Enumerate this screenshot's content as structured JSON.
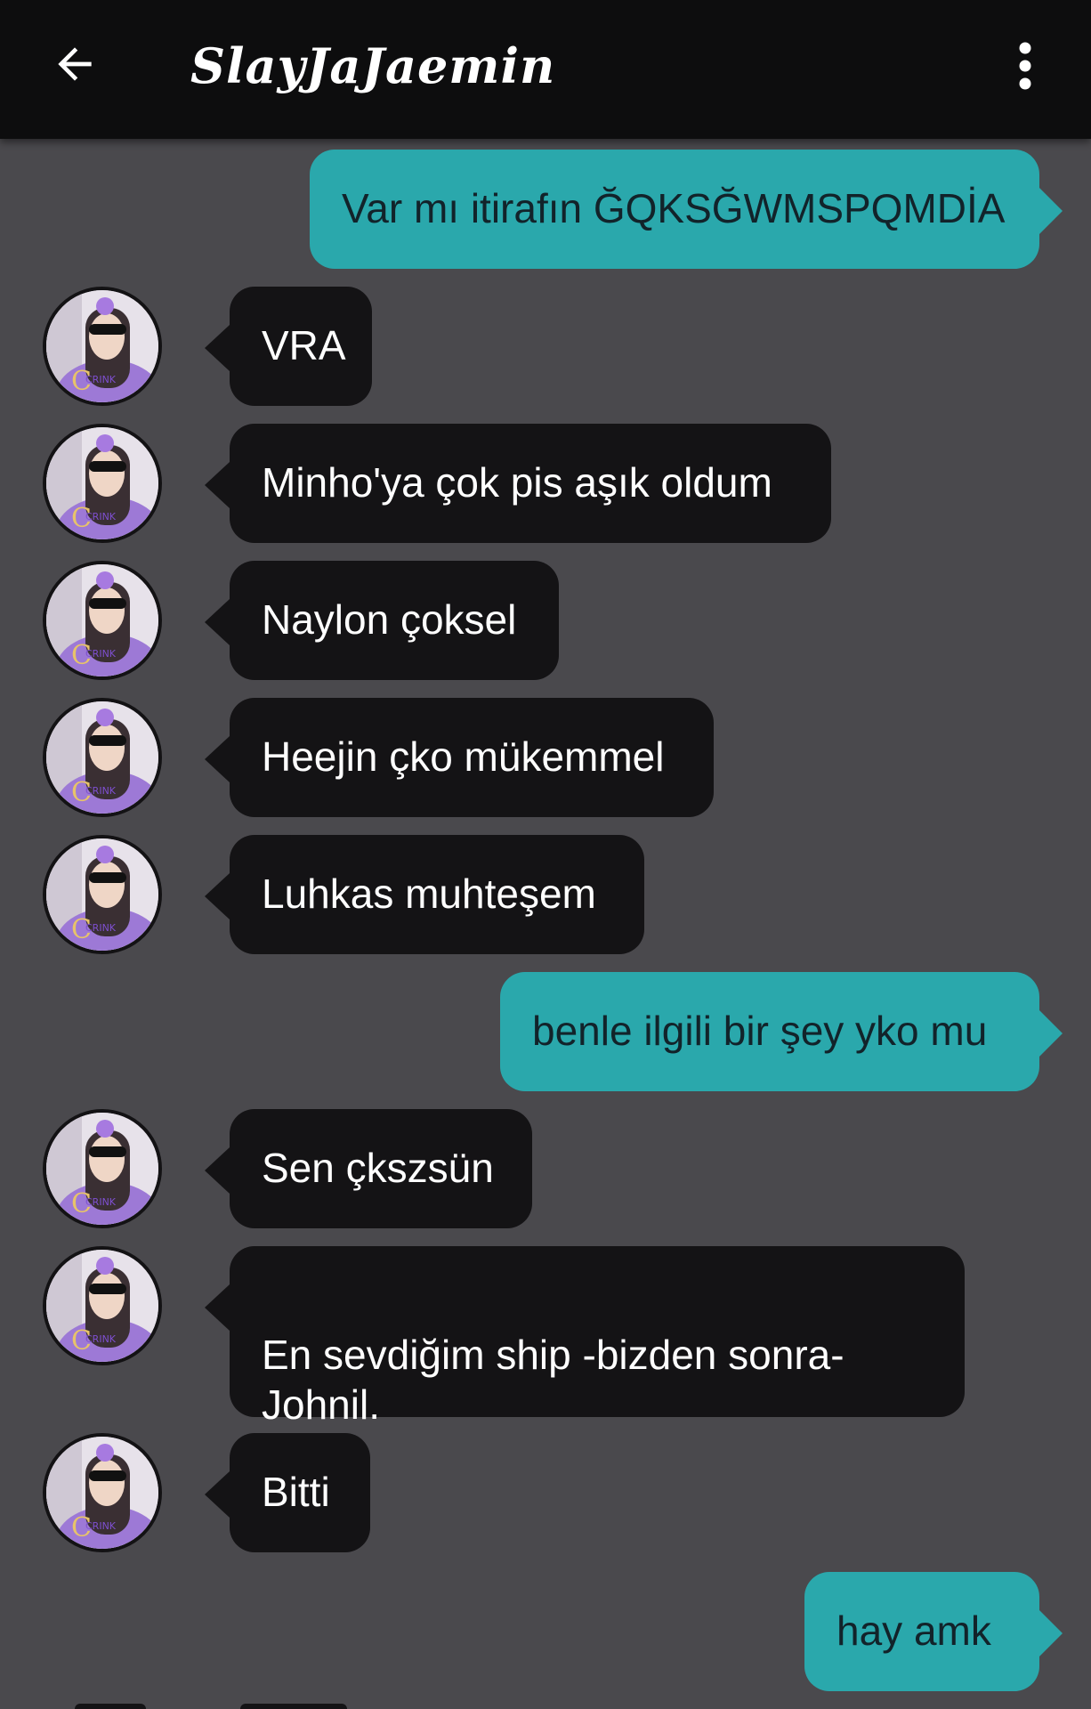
{
  "header": {
    "title": "SlayJaJaemin",
    "back_icon": "arrow-left-icon",
    "menu_icon": "vertical-dots-icon"
  },
  "colors": {
    "background": "#4a494d",
    "topbar": "#0d0d0e",
    "incoming_bubble": "#141315",
    "outgoing_bubble": "#2aa8ac"
  },
  "messages": [
    {
      "direction": "out",
      "text": "Var mı itirafın ĞQKSĞWMSPQMDİA"
    },
    {
      "direction": "in",
      "text": "VRA"
    },
    {
      "direction": "in",
      "text": "Minho'ya çok pis aşık oldum"
    },
    {
      "direction": "in",
      "text": "Naylon çoksel"
    },
    {
      "direction": "in",
      "text": "Heejin çko mükemmel"
    },
    {
      "direction": "in",
      "text": "Luhkas muhteşem"
    },
    {
      "direction": "out",
      "text": "benle ilgili bir şey yko mu"
    },
    {
      "direction": "in",
      "text": "Sen çkszsün"
    },
    {
      "direction": "in",
      "text": "En sevdiğim ship -bizden sonra-\nJohnil."
    },
    {
      "direction": "in",
      "text": "Bitti"
    },
    {
      "direction": "out",
      "text": "hay amk"
    }
  ]
}
